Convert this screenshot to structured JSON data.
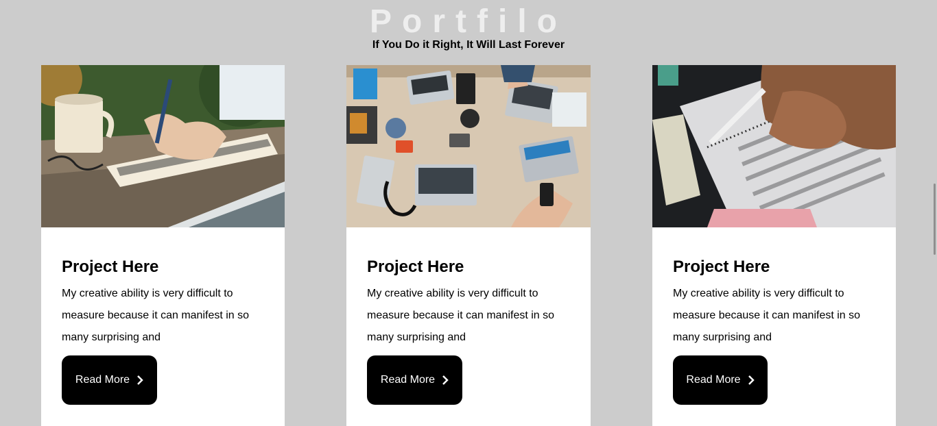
{
  "header": {
    "title": "Portfilo",
    "subtitle": "If You Do it Right, It Will Last Forever"
  },
  "cards": [
    {
      "image": "notebook-writing-photo",
      "title": "Project Here",
      "text": "My creative ability is very difficult to measure because it can manifest in so many surprising and",
      "button_label": "Read More",
      "button_icon": "chevron-right-icon"
    },
    {
      "image": "team-laptops-desk-photo",
      "title": "Project Here",
      "text": "My creative ability is very difficult to measure because it can manifest in so many surprising and",
      "button_label": "Read More",
      "button_icon": "chevron-right-icon"
    },
    {
      "image": "answer-sheet-pencil-photo",
      "title": "Project Here",
      "text": "My creative ability is very difficult to measure because it can manifest in so many surprising and",
      "button_label": "Read More",
      "button_icon": "chevron-right-icon"
    }
  ],
  "colors": {
    "background": "#cccccc",
    "card": "#ffffff",
    "button": "#000000",
    "title": "#eeeeee"
  }
}
